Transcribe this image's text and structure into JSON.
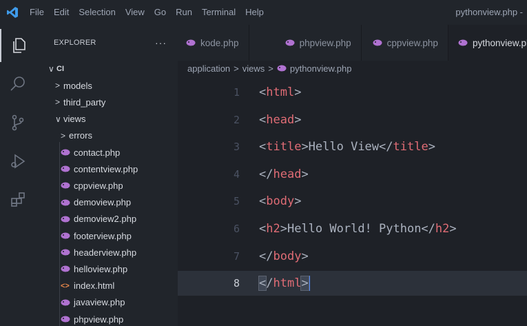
{
  "titlebar": {
    "menu": [
      "File",
      "Edit",
      "Selection",
      "View",
      "Go",
      "Run",
      "Terminal",
      "Help"
    ],
    "window_title": "pythonview.php -"
  },
  "activitybar": {
    "icons": [
      "files-icon",
      "search-icon",
      "source-control-icon",
      "run-debug-icon",
      "extensions-icon"
    ]
  },
  "sidebar": {
    "title": "EXPLORER",
    "more": "···",
    "tree": [
      {
        "label": "CI",
        "kind": "root",
        "chev": "∨"
      },
      {
        "label": "models",
        "kind": "folder",
        "chev": ">"
      },
      {
        "label": "third_party",
        "kind": "folder",
        "chev": ">"
      },
      {
        "label": "views",
        "kind": "folder",
        "chev": "∨"
      },
      {
        "label": "errors",
        "kind": "folder",
        "chev": ">"
      },
      {
        "label": "contact.php",
        "kind": "php"
      },
      {
        "label": "contentview.php",
        "kind": "php"
      },
      {
        "label": "cppview.php",
        "kind": "php"
      },
      {
        "label": "demoview.php",
        "kind": "php"
      },
      {
        "label": "demoview2.php",
        "kind": "php"
      },
      {
        "label": "footerview.php",
        "kind": "php"
      },
      {
        "label": "headerview.php",
        "kind": "php"
      },
      {
        "label": "helloview.php",
        "kind": "php"
      },
      {
        "label": "index.html",
        "kind": "html"
      },
      {
        "label": "javaview.php",
        "kind": "php"
      },
      {
        "label": "phpview.php",
        "kind": "php"
      }
    ]
  },
  "tabs": [
    {
      "label": "kode.php",
      "active": false
    },
    {
      "label": "phpview.php",
      "active": false
    },
    {
      "label": "cppview.php",
      "active": false
    },
    {
      "label": "pythonview.php",
      "active": true
    }
  ],
  "breadcrumb": [
    "application",
    "views",
    "pythonview.php"
  ],
  "editor": {
    "lines": [
      {
        "no": "1",
        "parts": [
          [
            "p",
            "<"
          ],
          [
            "t",
            "html"
          ],
          [
            "p",
            ">"
          ]
        ]
      },
      {
        "no": "2",
        "parts": [
          [
            "p",
            "<"
          ],
          [
            "t",
            "head"
          ],
          [
            "p",
            ">"
          ]
        ]
      },
      {
        "no": "3",
        "parts": [
          [
            "p",
            "<"
          ],
          [
            "t",
            "title"
          ],
          [
            "p",
            ">Hello View</"
          ],
          [
            "t",
            "title"
          ],
          [
            "p",
            ">"
          ]
        ]
      },
      {
        "no": "4",
        "parts": [
          [
            "p",
            "</"
          ],
          [
            "t",
            "head"
          ],
          [
            "p",
            ">"
          ]
        ]
      },
      {
        "no": "5",
        "parts": [
          [
            "p",
            "<"
          ],
          [
            "t",
            "body"
          ],
          [
            "p",
            ">"
          ]
        ]
      },
      {
        "no": "6",
        "parts": [
          [
            "p",
            "<"
          ],
          [
            "t",
            "h2"
          ],
          [
            "p",
            ">Hello World! Python</"
          ],
          [
            "t",
            "h2"
          ],
          [
            "p",
            ">"
          ]
        ]
      },
      {
        "no": "7",
        "parts": [
          [
            "p",
            "</"
          ],
          [
            "t",
            "body"
          ],
          [
            "p",
            ">"
          ]
        ]
      },
      {
        "no": "8",
        "parts": [
          [
            "b",
            "<"
          ],
          [
            "p",
            "/"
          ],
          [
            "t",
            "html"
          ],
          [
            "b",
            ">"
          ]
        ]
      }
    ],
    "current_line": 8
  },
  "colors": {
    "tag": "#e06c75",
    "accent": "#528bff",
    "php_icon": "#b072d1",
    "html_icon": "#e8874a"
  }
}
